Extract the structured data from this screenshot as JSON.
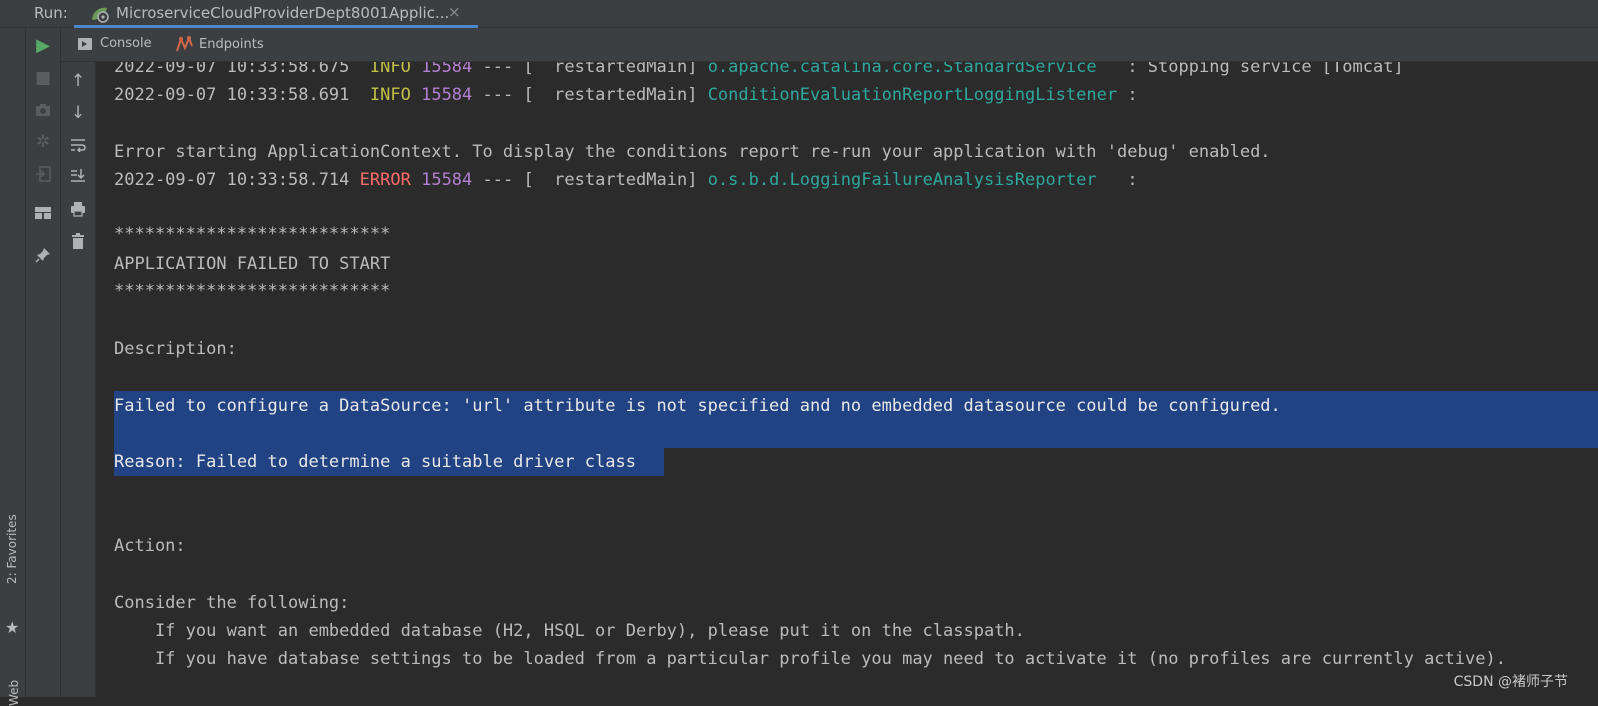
{
  "run_bar": {
    "label": "Run:",
    "tab_title": "MicroserviceCloudProviderDept8001Applic...",
    "close_glyph": "×"
  },
  "subtabs": {
    "console": "Console",
    "endpoints": "Endpoints"
  },
  "sidebar": {
    "favorites": "2: Favorites",
    "web": "Web"
  },
  "icons": {
    "run": "run-icon",
    "stop": "stop-icon",
    "camera": "dump-threads-icon",
    "settings": "settings-icon",
    "exit": "exit-icon",
    "layout": "layout-icon",
    "pin": "pin-icon",
    "up": "arrow-up-icon",
    "down": "arrow-down-icon",
    "wrap": "soft-wrap-icon",
    "scroll": "scroll-to-end-icon",
    "print": "print-icon",
    "trash": "clear-all-icon",
    "star": "star-icon"
  },
  "colors": {
    "info": "#c0c048",
    "error": "#ff6b68",
    "pid": "#b37fcf",
    "logger": "#2fa79d",
    "selection": "#214283",
    "run_green": "#59a869"
  },
  "log": {
    "l1": {
      "ts": "2022-09-07 10:33:58.675",
      "level": "INFO",
      "pid": "15584",
      "mid": " --- [  restartedMain] ",
      "logger": "o.apache.catalina.core.StandardService",
      "msg": "   : Stopping service [Tomcat]"
    },
    "l2": {
      "ts": "2022-09-07 10:33:58.691",
      "level": "INFO",
      "pid": "15584",
      "mid": " --- [  restartedMain] ",
      "logger": "ConditionEvaluationReportLoggingListener",
      "msg": " :"
    },
    "error_context": "Error starting ApplicationContext. To display the conditions report re-run your application with 'debug' enabled.",
    "l3": {
      "ts": "2022-09-07 10:33:58.714",
      "level": "ERROR",
      "pid": "15584",
      "mid": " --- [  restartedMain] ",
      "logger": "o.s.b.d.LoggingFailureAnalysisReporter",
      "msg": "   :"
    },
    "stars": "***************************",
    "failed_title": "APPLICATION FAILED TO START",
    "description_label": "Description:",
    "description_text": "Failed to configure a DataSource: 'url' attribute is not specified and no embedded datasource could be configured.",
    "reason": "Reason: Failed to determine a suitable driver class",
    "action_label": "Action:",
    "consider": "Consider the following:",
    "suggestion_1": "    If you want an embedded database (H2, HSQL or Derby), please put it on the classpath.",
    "suggestion_2": "    If you have database settings to be loaded from a particular profile you may need to activate it (no profiles are currently active)."
  },
  "watermark": "CSDN @褚师子节"
}
